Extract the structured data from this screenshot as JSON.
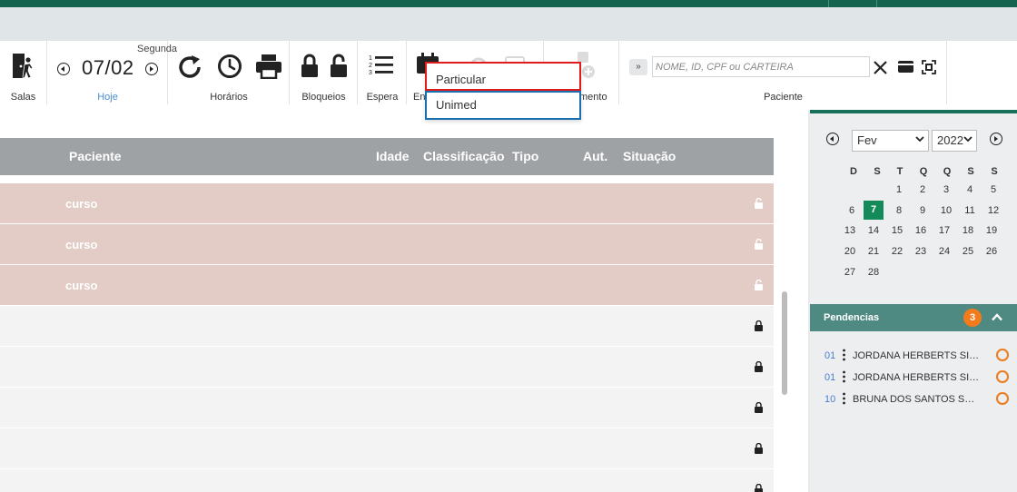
{
  "toolbar": {
    "salas_label": "Salas",
    "date": {
      "day_name": "Segunda",
      "date": "07/02",
      "today_label": "Hoje"
    },
    "horarios_label": "Horários",
    "bloqueios_label": "Bloqueios",
    "espera_label": "Espera",
    "en_label_partial": "En",
    "atendimento_label_partial": "mento",
    "paciente_label": "Paciente",
    "expand_label": "»",
    "search_placeholder": "NOME, ID, CPF ou CARTEIRA"
  },
  "dropdown": {
    "items": [
      "Particular",
      "Unimed"
    ]
  },
  "table": {
    "headers": [
      "Paciente",
      "Idade",
      "Classificação",
      "Tipo",
      "Aut.",
      "Situação"
    ],
    "rows": [
      {
        "text": "curso",
        "style": "blocked"
      },
      {
        "text": "curso",
        "style": "blocked"
      },
      {
        "text": "curso",
        "style": "blocked"
      },
      {
        "text": "",
        "style": "locked"
      },
      {
        "text": "",
        "style": "locked"
      },
      {
        "text": "",
        "style": "locked"
      },
      {
        "text": "",
        "style": "locked"
      },
      {
        "text": "",
        "style": "locked"
      }
    ]
  },
  "calendar": {
    "month": "Fev",
    "year": "2022",
    "weekdays": [
      "D",
      "S",
      "T",
      "Q",
      "Q",
      "S",
      "S"
    ],
    "days": [
      "1",
      "2",
      "3",
      "4",
      "5",
      "6",
      "7",
      "8",
      "9",
      "10",
      "11",
      "12",
      "13",
      "14",
      "15",
      "16",
      "17",
      "18",
      "19",
      "20",
      "21",
      "22",
      "23",
      "24",
      "25",
      "26",
      "27",
      "28"
    ],
    "today": "7"
  },
  "pendencias": {
    "title": "Pendencias",
    "count": "3",
    "items": [
      {
        "num": "01",
        "name": "JORDANA HERBERTS SILVEIRA"
      },
      {
        "num": "01",
        "name": "JORDANA HERBERTS SILVEIRA"
      },
      {
        "num": "10",
        "name": "BRUNA DOS SANTOS SCHNEIDER"
      }
    ]
  },
  "colors": {
    "brand_green": "#14634f",
    "accent_orange": "#f27b1c",
    "blocked_row": "#e3ccc5",
    "pendencias_header": "#4f8a82"
  }
}
